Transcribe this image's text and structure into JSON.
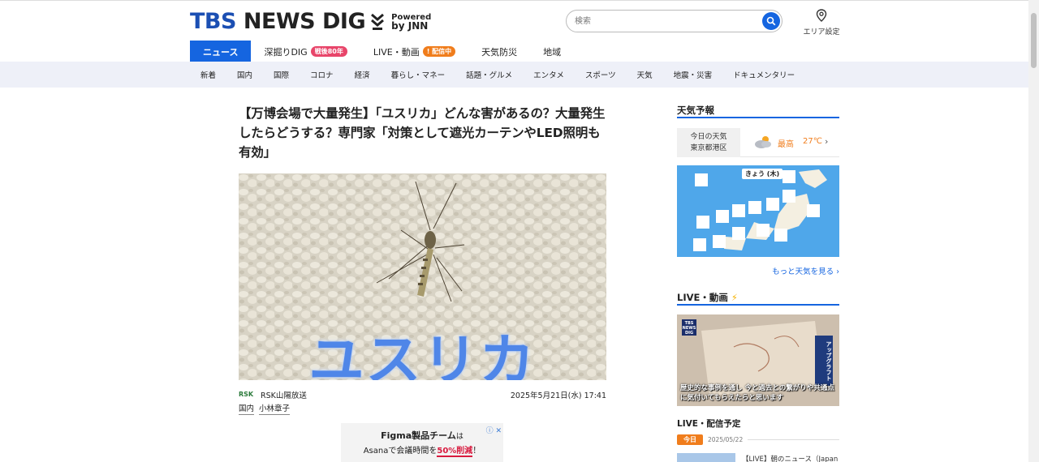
{
  "header": {
    "logo_tbs": "TBS",
    "logo_main": " NEWS DIG",
    "logo_powered": "Powered",
    "logo_by": "by JNN",
    "search_placeholder": "検索",
    "area_label": "エリア設定"
  },
  "mainnav": [
    {
      "label": "ニュース",
      "active": true
    },
    {
      "label": "深掘りDIG",
      "badge": "戦後80年",
      "badge_color": "#e8456a"
    },
    {
      "label": "LIVE・動画",
      "badge": "配信中",
      "badge_color": "#f07d1c"
    },
    {
      "label": "天気防災"
    },
    {
      "label": "地域"
    }
  ],
  "subnav": [
    "新着",
    "国内",
    "国際",
    "コロナ",
    "経済",
    "暮らし・マネー",
    "話題・グルメ",
    "エンタメ",
    "スポーツ",
    "天気",
    "地震・災害",
    "ドキュメンタリー"
  ],
  "article": {
    "headline": "【万博会場で大量発生】「ユスリカ」どんな害があるの？大量発生したらどうする？専門家「対策として遮光カーテンやLED照明も有効」",
    "image_overlay_text": "ユスリカ",
    "source_logo": "RSK",
    "source_name": "RSK山陽放送",
    "datetime": "2025年5月21日(水) 17:41",
    "tags": [
      "国内",
      "小林章子"
    ]
  },
  "ad": {
    "line1_bold": "Figma製品チーム",
    "line1_small": "は",
    "line2_pre": "Asanaで会議時間を",
    "line2_highlight": "50%削減",
    "line2_post": "！",
    "marks": "ⓘ ✕"
  },
  "sidebar": {
    "weather_title": "天気予報",
    "weather_loc_line1": "今日の天気",
    "weather_loc_line2": "東京都港区",
    "weather_high_label": "最高",
    "weather_temp": "27℃",
    "map_title": "きょう (木)",
    "more_weather": "もっと天気を見る ›",
    "live_title": "LIVE・動画",
    "video_caption": "歴史的な事例を通し 今と過去との繋がりや共通点に気付いてもらえたらと思います",
    "video_side": "アップグラフト",
    "video_logo": "TBS NEWS DIG",
    "schedule_title": "LIVE・配信予定",
    "today_badge": "今日",
    "schedule_date": "2025/05/22",
    "schedule_item": "【LIVE】朝のニュース（Japan"
  },
  "colors": {
    "brand_blue": "#1565e0",
    "accent_orange": "#f07d1c",
    "badge_red": "#e8456a",
    "subnav_bg": "#eef0f8"
  }
}
